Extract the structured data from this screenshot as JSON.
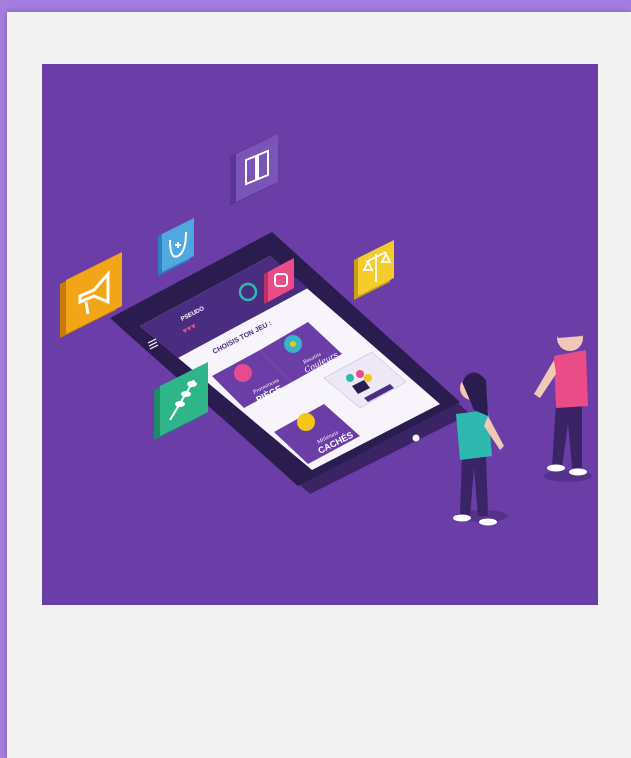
{
  "image": {
    "scene": "isometric-phone-app-illustration",
    "background_color": "#6a3ea6",
    "frame_color": "#f2f2f2",
    "page_color": "#a57de0"
  },
  "phone": {
    "header_name": "PSEUDO",
    "screen_title": "CHOISIS TON JEU :",
    "hearts": "♥♥♥",
    "cards": [
      {
        "line1": "Promenons",
        "line2": "PIÈGE",
        "color": "#6a3ea6",
        "icon_color": "#e64a8f"
      },
      {
        "line1": "Besoins",
        "line2": "Couleurs",
        "color": "#6a3ea6",
        "icon_color": "#37b2c9"
      },
      {
        "line1": "Millénais",
        "line2": "CACHÉS",
        "color": "#6a3ea6",
        "icon_color": "#f5c518"
      },
      {
        "line1": "",
        "line2": "",
        "color": "#ece8f5",
        "icon_color": "#6a3ea6"
      }
    ]
  },
  "floating_icons": [
    {
      "icon": "book-icon",
      "color": "#7b54b8"
    },
    {
      "icon": "stethoscope-icon",
      "color": "#4fa8e0"
    },
    {
      "icon": "megaphone-icon",
      "color": "#f2a516"
    },
    {
      "icon": "shopping-bag-icon",
      "color": "#e94c86"
    },
    {
      "icon": "scales-icon",
      "color": "#f4cc2e"
    },
    {
      "icon": "wheat-icon",
      "color": "#2fb58a"
    }
  ],
  "people": [
    {
      "name": "woman",
      "shirt_color": "#2fb8b0"
    },
    {
      "name": "man",
      "shirt_color": "#e94c86"
    }
  ]
}
